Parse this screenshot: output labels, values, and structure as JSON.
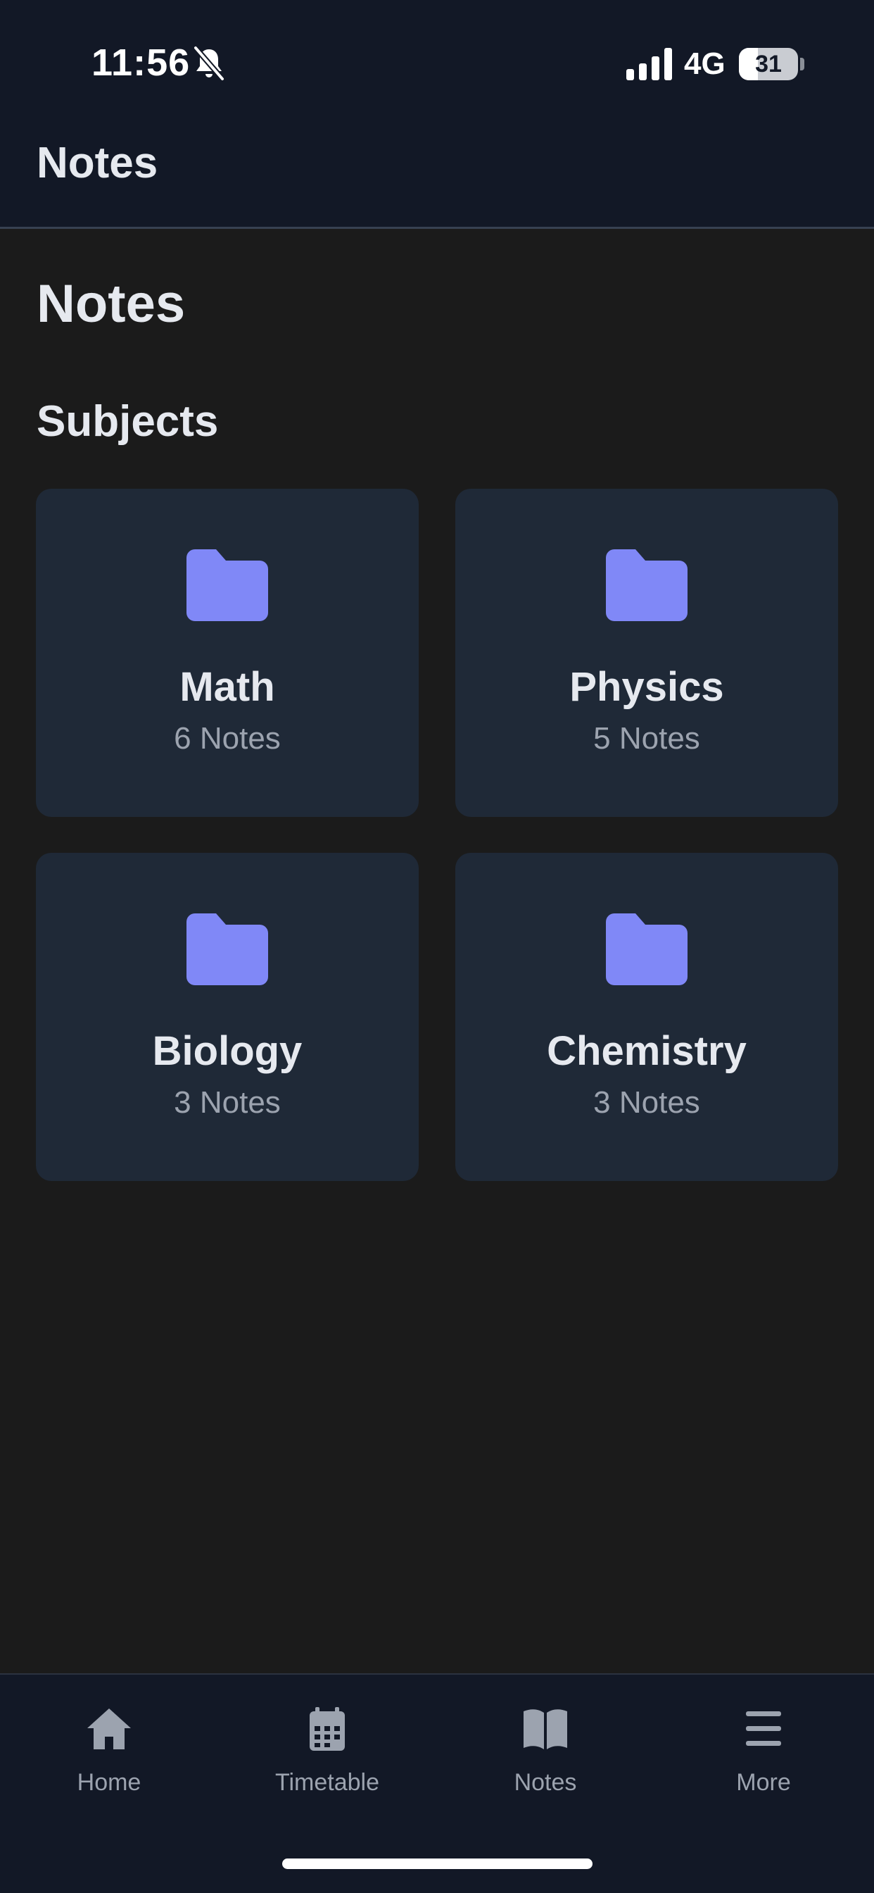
{
  "status_bar": {
    "time": "11:56",
    "network": "4G",
    "battery": "31",
    "icons": [
      "bell-slash-icon",
      "signal-icon",
      "battery-icon"
    ]
  },
  "header": {
    "title": "Notes"
  },
  "page": {
    "title": "Notes",
    "section_title": "Subjects",
    "subjects": [
      {
        "name": "Math",
        "count": "6 Notes",
        "icon": "folder-icon"
      },
      {
        "name": "Physics",
        "count": "5 Notes",
        "icon": "folder-icon"
      },
      {
        "name": "Biology",
        "count": "3 Notes",
        "icon": "folder-icon"
      },
      {
        "name": "Chemistry",
        "count": "3 Notes",
        "icon": "folder-icon"
      }
    ]
  },
  "bottom_nav": {
    "items": [
      {
        "label": "Home",
        "icon": "home-icon"
      },
      {
        "label": "Timetable",
        "icon": "calendar-icon"
      },
      {
        "label": "Notes",
        "icon": "book-icon"
      },
      {
        "label": "More",
        "icon": "menu-icon"
      }
    ]
  },
  "colors": {
    "background": "#1b1b1b",
    "header_background": "#121826",
    "card_background": "#1f2937",
    "folder_accent": "#8088f7",
    "text_primary": "#e6e9ef",
    "text_secondary": "#9ca3af"
  }
}
